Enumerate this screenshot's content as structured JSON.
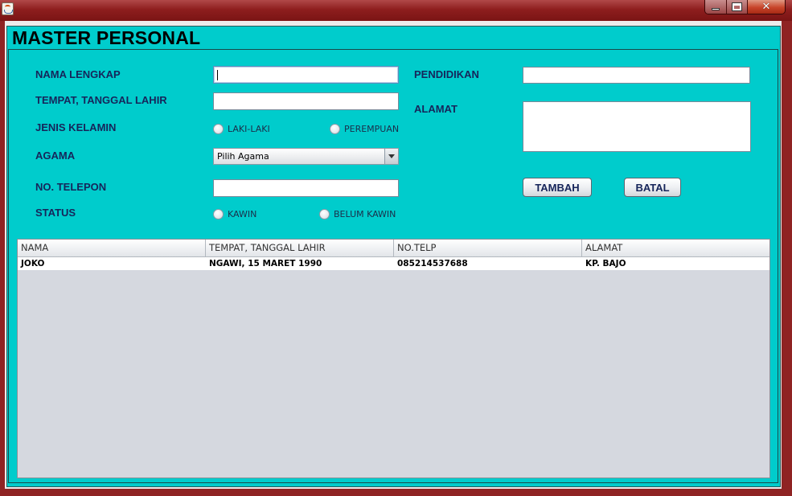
{
  "window": {
    "icon": "java-cup-icon",
    "controls": [
      "minimize",
      "maximize",
      "close"
    ]
  },
  "page_title": "MASTER PERSONAL",
  "form": {
    "nama_lengkap": {
      "label": "NAMA LENGKAP",
      "value": ""
    },
    "tempat_tanggal_lahir": {
      "label": "TEMPAT, TANGGAL LAHIR",
      "value": ""
    },
    "jenis_kelamin": {
      "label": "JENIS KELAMIN",
      "options": [
        "LAKI-LAKI",
        "PEREMPUAN"
      ]
    },
    "agama": {
      "label": "AGAMA",
      "selected": "Pilih Agama"
    },
    "no_telepon": {
      "label": "NO. TELEPON",
      "value": ""
    },
    "status": {
      "label": "STATUS",
      "options": [
        "KAWIN",
        "BELUM KAWIN"
      ]
    },
    "pendidikan": {
      "label": "PENDIDIKAN",
      "value": ""
    },
    "alamat": {
      "label": "ALAMAT",
      "value": ""
    },
    "buttons": {
      "tambah": "TAMBAH",
      "batal": "BATAL"
    }
  },
  "table": {
    "columns": [
      "NAMA",
      "TEMPAT, TANGGAL LAHIR",
      "NO.TELP",
      "ALAMAT"
    ],
    "rows": [
      [
        "JOKO",
        "NGAWI, 15 MARET 1990",
        "085214537688",
        "KP. BAJO"
      ]
    ]
  },
  "colors": {
    "panel_bg": "#00cccc",
    "label_text": "#16255a",
    "title_bar": "#8e1e1e",
    "table_bg": "#d5d8df"
  }
}
